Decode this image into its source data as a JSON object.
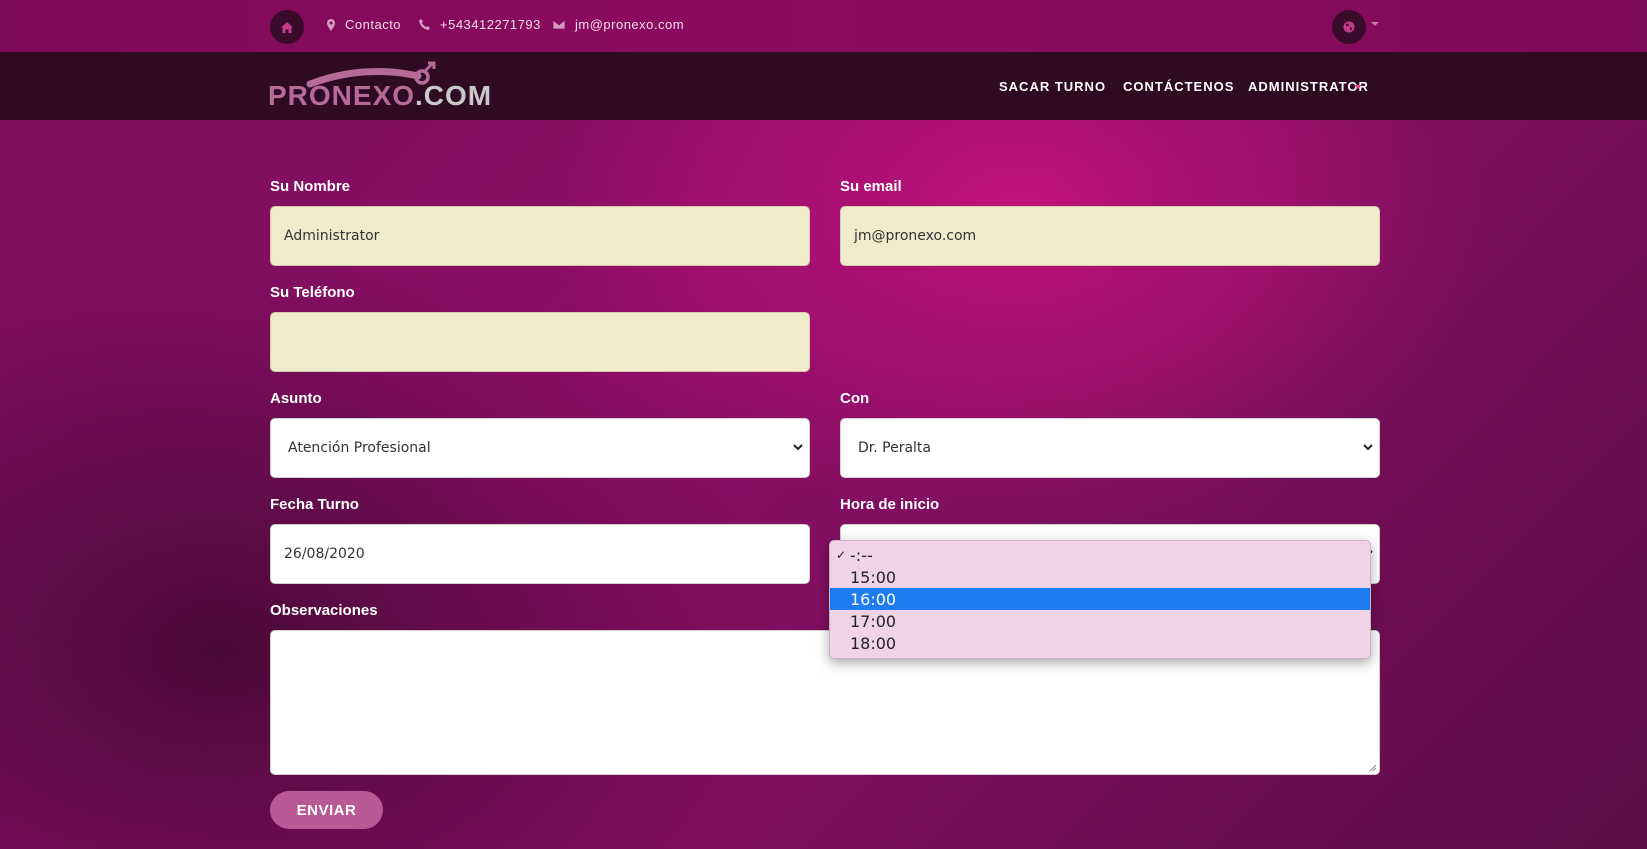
{
  "topbar": {
    "contact_label": "Contacto",
    "phone": "+543412271793",
    "email": "jm@pronexo.com",
    "icons": [
      "home-icon",
      "map-marker-icon",
      "phone-icon",
      "envelope-icon",
      "globe-icon"
    ]
  },
  "logo": {
    "part1": "PRONEXO",
    "part2": ".COM"
  },
  "nav": {
    "items": [
      "SACAR TURNO",
      "CONTÁCTENOS",
      "ADMINISTRATOR"
    ]
  },
  "form": {
    "name_label": "Su Nombre",
    "name_value": "Administrator",
    "email_label": "Su email",
    "email_value": "jm@pronexo.com",
    "phone_label": "Su Teléfono",
    "phone_value": "",
    "subject_label": "Asunto",
    "subject_value": "Atención Profesional",
    "with_label": "Con",
    "with_value": "Dr. Peralta",
    "date_label": "Fecha Turno",
    "date_value": "26/08/2020",
    "time_label": "Hora de inicio",
    "notes_label": "Observaciones",
    "submit_label": "ENVIAR"
  },
  "time_dropdown": {
    "options": [
      "-:--",
      "15:00",
      "16:00",
      "17:00",
      "18:00"
    ],
    "selected_index": 0,
    "highlighted_index": 2,
    "checkmark": "✓"
  },
  "colors": {
    "topbar": "#8d0b61",
    "navbar": "#2e0a23",
    "field_bg": "#efeccb",
    "button": "#b95a96",
    "highlight": "#1e7cf1"
  }
}
